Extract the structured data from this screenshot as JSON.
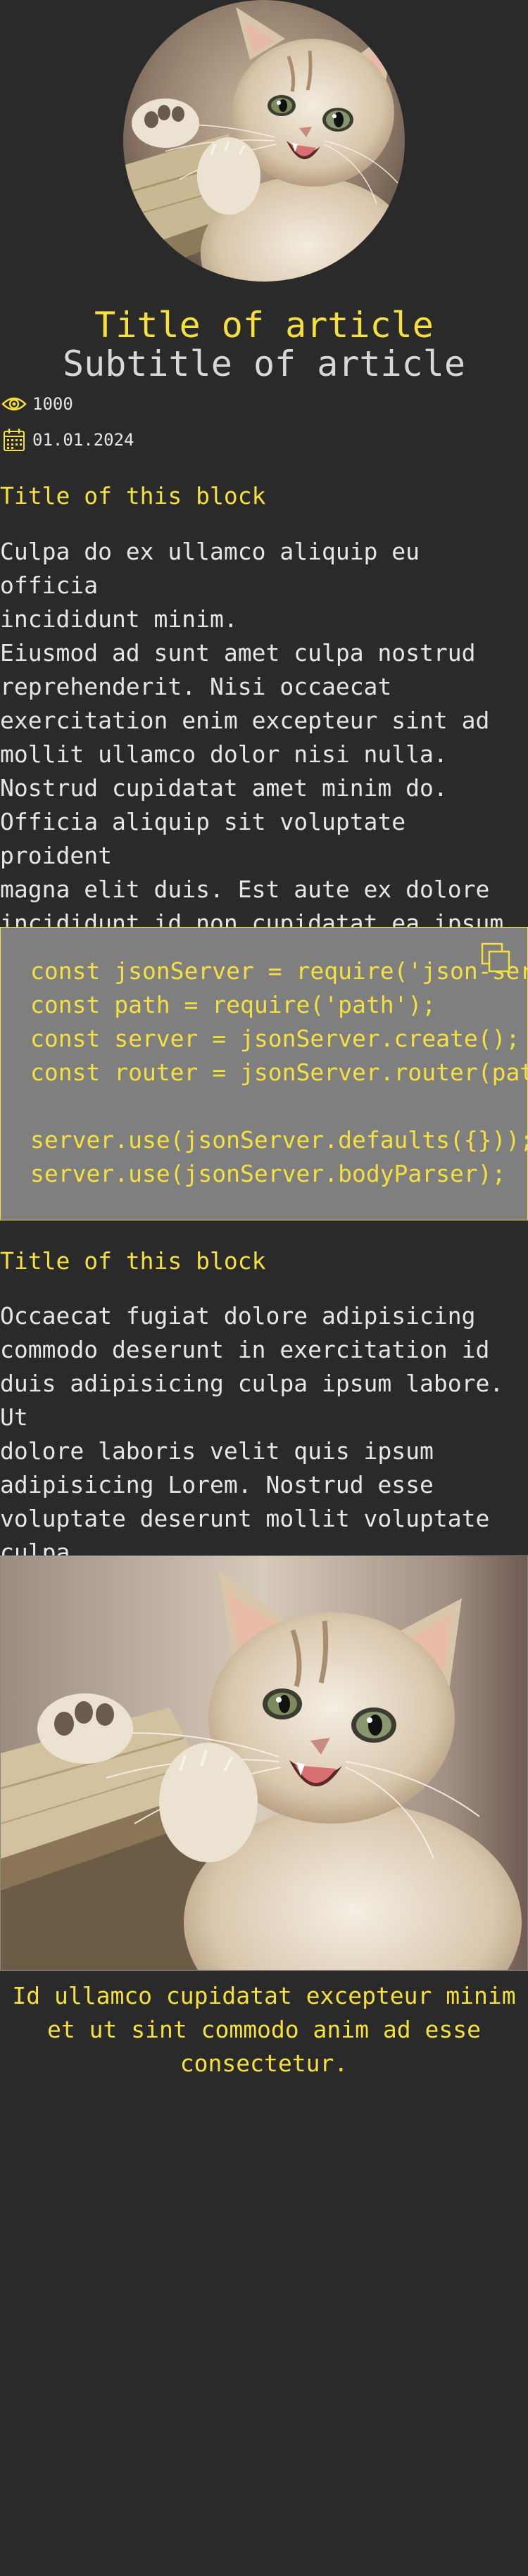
{
  "article": {
    "title": "Title of article",
    "subtitle": "Subtitle of article",
    "views": "1000",
    "date": "01.01.2024"
  },
  "icons": {
    "views": "eye-icon",
    "date": "calendar-icon",
    "copy": "copy-icon"
  },
  "blocks": [
    {
      "title": "Title of this block",
      "text": "Culpa do ex ullamco aliquip eu officia\nincididunt minim.\nEiusmod ad sunt amet culpa nostrud\nreprehenderit. Nisi occaecat\nexercitation enim excepteur sint ad\nmollit ullamco dolor nisi nulla.\nNostrud cupidatat amet minim do.\nOfficia aliquip sit voluptate proident\nmagna elit duis. Est aute ex dolore\nincididunt id non cupidatat ea ipsum\nsunt veniam."
    },
    {
      "code": "const jsonServer = require('json-server');\nconst path = require('path');\nconst server = jsonServer.create();\nconst router = jsonServer.router(path.resolve(__dirname, 'db.json'));\n\nserver.use(jsonServer.defaults({}));\nserver.use(jsonServer.bodyParser);"
    },
    {
      "title": "Title of this block",
      "text": "Occaecat fugiat dolore adipisicing\ncommodo deserunt in exercitation id\nduis adipisicing culpa ipsum labore. Ut\ndolore laboris velit quis ipsum\nadipisicing Lorem. Nostrud esse\nvoluptate deserunt mollit voluptate\nculpa."
    },
    {
      "caption": "Id ullamco cupidatat excepteur minim et\nut sint commodo anim ad esse\nconsectetur."
    }
  ],
  "colors": {
    "background": "#2a2a2a",
    "accent": "#f5e040",
    "text": "#e6e6e6",
    "code_background": "#7f7f7f"
  }
}
